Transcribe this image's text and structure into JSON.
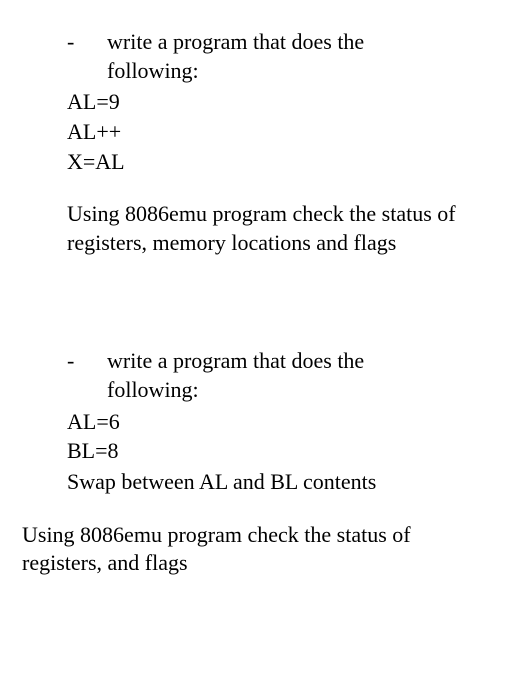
{
  "exercise1": {
    "bullet": "-",
    "prompt_line1": "write a program that does the",
    "prompt_line2": "following:",
    "code": {
      "line1": "AL=9",
      "line2": "AL++",
      "line3": "X=AL"
    },
    "instruction": "Using 8086emu program check the status of registers, memory locations and flags"
  },
  "exercise2": {
    "bullet": "-",
    "prompt_line1": "write a program that does the",
    "prompt_line2": "following:",
    "code": {
      "line1": "AL=6",
      "line2": "BL=8"
    },
    "swap": "Swap between AL and BL contents",
    "instruction": "Using 8086emu program check the status of registers, and flags"
  }
}
